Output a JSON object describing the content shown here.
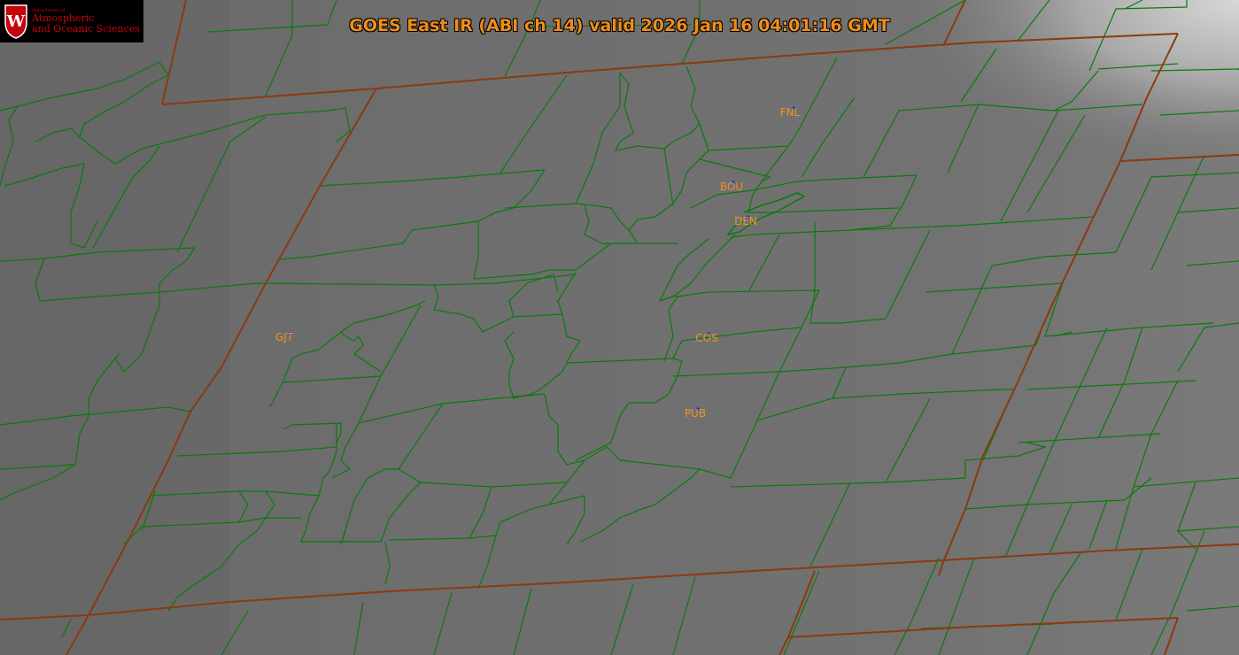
{
  "title": "GOES East IR (ABI ch 14) valid 2026 Jan 16 04:01:16 GMT",
  "logo": {
    "department_line": "Department of",
    "line1": "Atmospheric",
    "line2": "and Oceanic Sciences",
    "crest_letter": "W"
  },
  "stations": [
    {
      "id": "FNL",
      "label": "FNL"
    },
    {
      "id": "BOU",
      "label": "BOU"
    },
    {
      "id": "DEN",
      "label": "DEN"
    },
    {
      "id": "GJT",
      "label": "GJT"
    },
    {
      "id": "COS",
      "label": "COS"
    },
    {
      "id": "PUB",
      "label": "PUB"
    }
  ],
  "colors": {
    "background": "#6b6b6b",
    "county_lines": "#0b7a0b",
    "state_lines": "#8a3a10",
    "title": "#f08c1a",
    "station_labels": "#f0921e",
    "station_dots": "#1030ff",
    "logo_text": "#c5050c"
  }
}
